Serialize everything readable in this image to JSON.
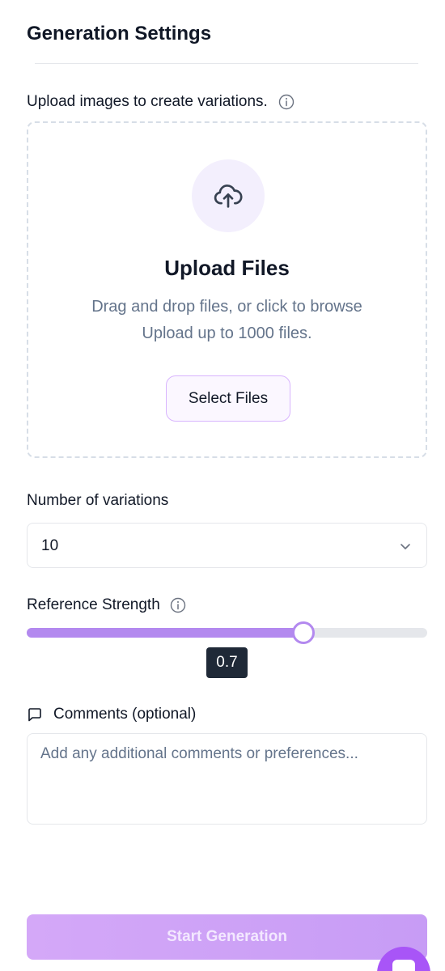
{
  "panel": {
    "title": "Generation Settings"
  },
  "upload": {
    "label": "Upload images to create variations.",
    "heading": "Upload Files",
    "description": "Drag and drop files, or click to browse",
    "limit": "Upload up to 1000 files.",
    "button_label": "Select Files",
    "icon": "cloud-upload-icon"
  },
  "variations": {
    "label": "Number of variations",
    "value": "10"
  },
  "strength": {
    "label": "Reference Strength",
    "value": "0.7",
    "fraction": 0.69
  },
  "comments": {
    "label": "Comments (optional)",
    "placeholder": "Add any additional comments or preferences..."
  },
  "actions": {
    "start_label": "Start Generation"
  },
  "colors": {
    "accent": "#b389ef",
    "accent_light": "#f3effd",
    "badge": "#1f2937"
  }
}
